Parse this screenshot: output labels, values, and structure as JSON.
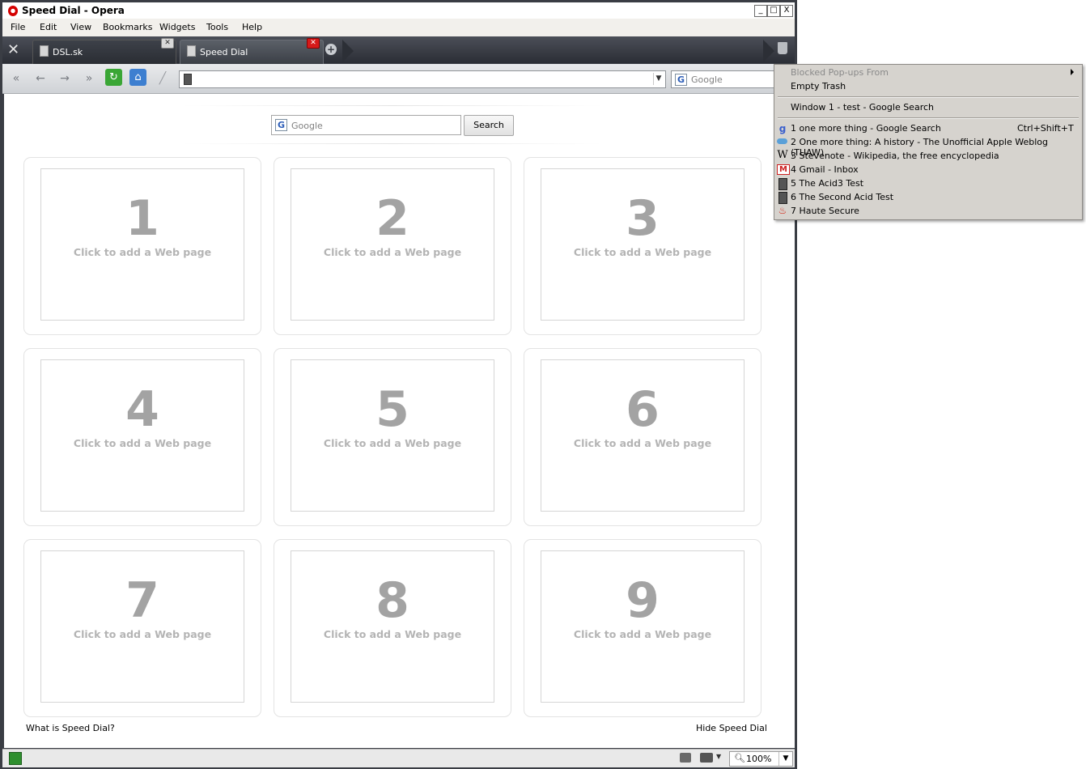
{
  "window": {
    "title": "Speed Dial - Opera",
    "controls": {
      "minimize": "_",
      "maximize": "□",
      "close": "X"
    }
  },
  "menubar": {
    "items": [
      "File",
      "Edit",
      "View",
      "Bookmarks",
      "Widgets",
      "Tools",
      "Help"
    ]
  },
  "tabs": [
    {
      "label": "DSL.sk",
      "active": false
    },
    {
      "label": "Speed Dial",
      "active": true
    }
  ],
  "toolbar": {
    "icons": [
      "rewind-icon",
      "back-icon",
      "forward-icon",
      "fast-forward-icon",
      "reload-icon",
      "home-icon",
      "wand-icon"
    ],
    "address_value": "",
    "search_placeholder": "Google"
  },
  "speed_dial": {
    "search_placeholder": "Google",
    "search_button": "Search",
    "cells": [
      {
        "number": "1",
        "text": "Click to add a Web page"
      },
      {
        "number": "2",
        "text": "Click to add a Web page"
      },
      {
        "number": "3",
        "text": "Click to add a Web page"
      },
      {
        "number": "4",
        "text": "Click to add a Web page"
      },
      {
        "number": "5",
        "text": "Click to add a Web page"
      },
      {
        "number": "6",
        "text": "Click to add a Web page"
      },
      {
        "number": "7",
        "text": "Click to add a Web page"
      },
      {
        "number": "8",
        "text": "Click to add a Web page"
      },
      {
        "number": "9",
        "text": "Click to add a Web page"
      }
    ],
    "footer_left": "What is Speed Dial?",
    "footer_right": "Hide Speed Dial"
  },
  "statusbar": {
    "zoom": "100%"
  },
  "trash_menu": {
    "blocked_popups": "Blocked Pop-ups From",
    "empty_trash": "Empty Trash",
    "closed_window": "Window 1 - test - Google Search",
    "closed_tabs": [
      {
        "label": "1 one more thing - Google Search",
        "shortcut": "Ctrl+Shift+T",
        "icon": "google-icon"
      },
      {
        "label": "2 One more thing: A history - The Unofficial Apple Weblog (TUAW)",
        "shortcut": "",
        "icon": "tuaw-icon"
      },
      {
        "label": "3 Stevenote - Wikipedia, the free encyclopedia",
        "shortcut": "",
        "icon": "wikipedia-icon"
      },
      {
        "label": "4 Gmail - Inbox",
        "shortcut": "",
        "icon": "gmail-icon"
      },
      {
        "label": "5 The Acid3 Test",
        "shortcut": "",
        "icon": "document-icon"
      },
      {
        "label": "6 The Second Acid Test",
        "shortcut": "",
        "icon": "document-icon"
      },
      {
        "label": "7 Haute Secure",
        "shortcut": "",
        "icon": "flame-icon"
      }
    ]
  },
  "colors": {
    "frame": "#3a3d44",
    "menu_bg": "#d6d3ce",
    "speed_dial_number": "#a3a3a3",
    "speed_dial_text": "#b4b4b4"
  }
}
